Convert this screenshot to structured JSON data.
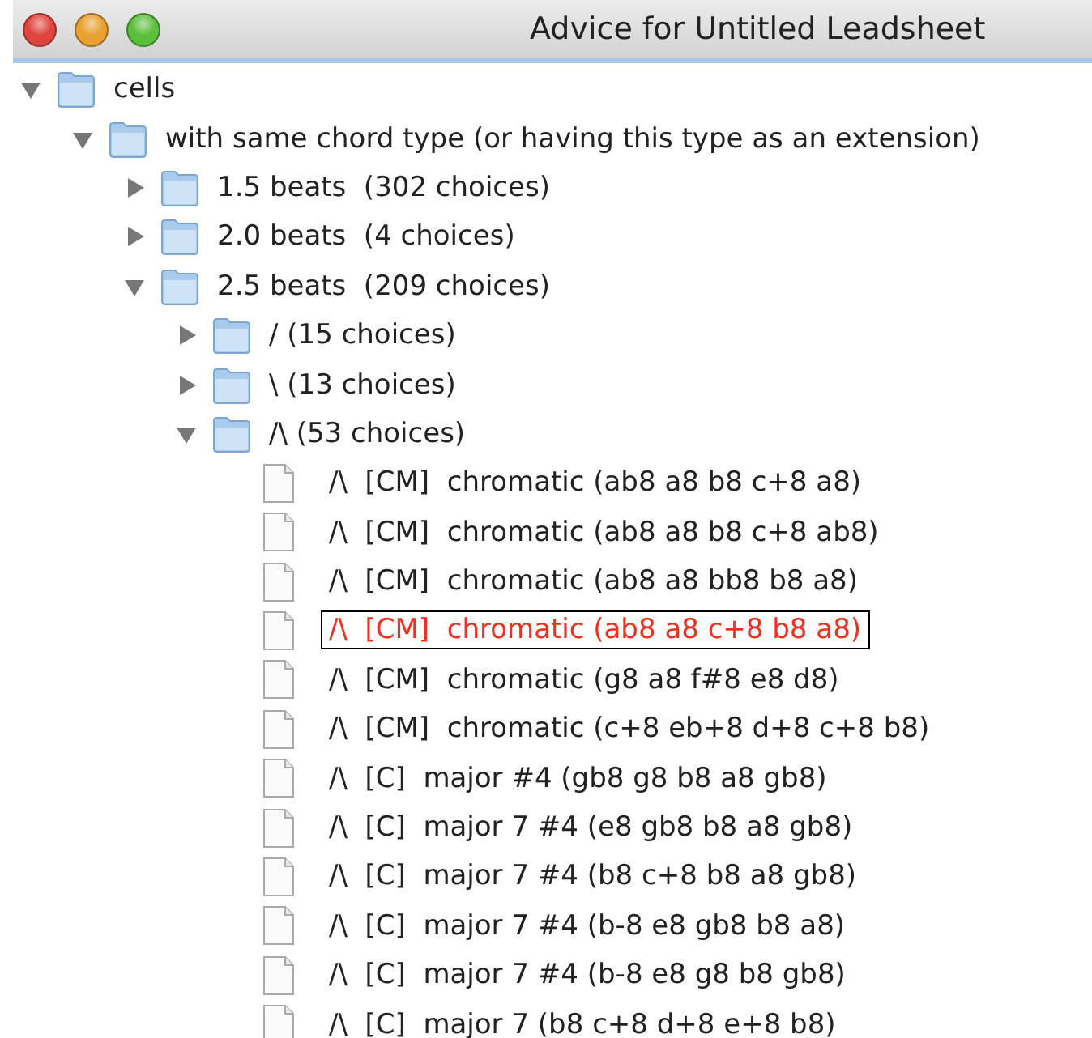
{
  "window": {
    "title": "Advice for Untitled Leadsheet"
  },
  "tree": [
    {
      "kind": "folder",
      "label": "cells",
      "expanded": true,
      "selected": false,
      "children": [
        {
          "kind": "folder",
          "label": "with same chord type (or having this type as an extension)",
          "expanded": true,
          "selected": false,
          "children": [
            {
              "kind": "folder",
              "label": "1.5 beats  (302 choices)",
              "expanded": false,
              "selected": false
            },
            {
              "kind": "folder",
              "label": "2.0 beats  (4 choices)",
              "expanded": false,
              "selected": false
            },
            {
              "kind": "folder",
              "label": "2.5 beats  (209 choices)",
              "expanded": true,
              "selected": false,
              "children": [
                {
                  "kind": "folder",
                  "label": "/ (15 choices)",
                  "expanded": false,
                  "selected": false
                },
                {
                  "kind": "folder",
                  "label": "\\ (13 choices)",
                  "expanded": false,
                  "selected": false
                },
                {
                  "kind": "folder",
                  "label": "/\\ (53 choices)",
                  "expanded": true,
                  "selected": false,
                  "children": [
                    {
                      "kind": "leaf",
                      "label": "/\\  [CM]  chromatic (ab8 a8 b8 c+8 a8)",
                      "selected": false
                    },
                    {
                      "kind": "leaf",
                      "label": "/\\  [CM]  chromatic (ab8 a8 b8 c+8 ab8)",
                      "selected": false
                    },
                    {
                      "kind": "leaf",
                      "label": "/\\  [CM]  chromatic (ab8 a8 bb8 b8 a8)",
                      "selected": false
                    },
                    {
                      "kind": "leaf",
                      "label": "/\\  [CM]  chromatic (ab8 a8 c+8 b8 a8)",
                      "selected": true
                    },
                    {
                      "kind": "leaf",
                      "label": "/\\  [CM]  chromatic (g8 a8 f#8 e8 d8)",
                      "selected": false
                    },
                    {
                      "kind": "leaf",
                      "label": "/\\  [CM]  chromatic (c+8 eb+8 d+8 c+8 b8)",
                      "selected": false
                    },
                    {
                      "kind": "leaf",
                      "label": "/\\  [C]  major #4 (gb8 g8 b8 a8 gb8)",
                      "selected": false
                    },
                    {
                      "kind": "leaf",
                      "label": "/\\  [C]  major 7 #4 (e8 gb8 b8 a8 gb8)",
                      "selected": false
                    },
                    {
                      "kind": "leaf",
                      "label": "/\\  [C]  major 7 #4 (b8 c+8 b8 a8 gb8)",
                      "selected": false
                    },
                    {
                      "kind": "leaf",
                      "label": "/\\  [C]  major 7 #4 (b-8 e8 gb8 b8 a8)",
                      "selected": false
                    },
                    {
                      "kind": "leaf",
                      "label": "/\\  [C]  major 7 #4 (b-8 e8 g8 b8 gb8)",
                      "selected": false
                    },
                    {
                      "kind": "leaf",
                      "label": "/\\  [C]  major 7 (b8 c+8 d+8 e+8 b8)",
                      "selected": false
                    }
                  ]
                }
              ]
            }
          ]
        }
      ]
    }
  ]
}
